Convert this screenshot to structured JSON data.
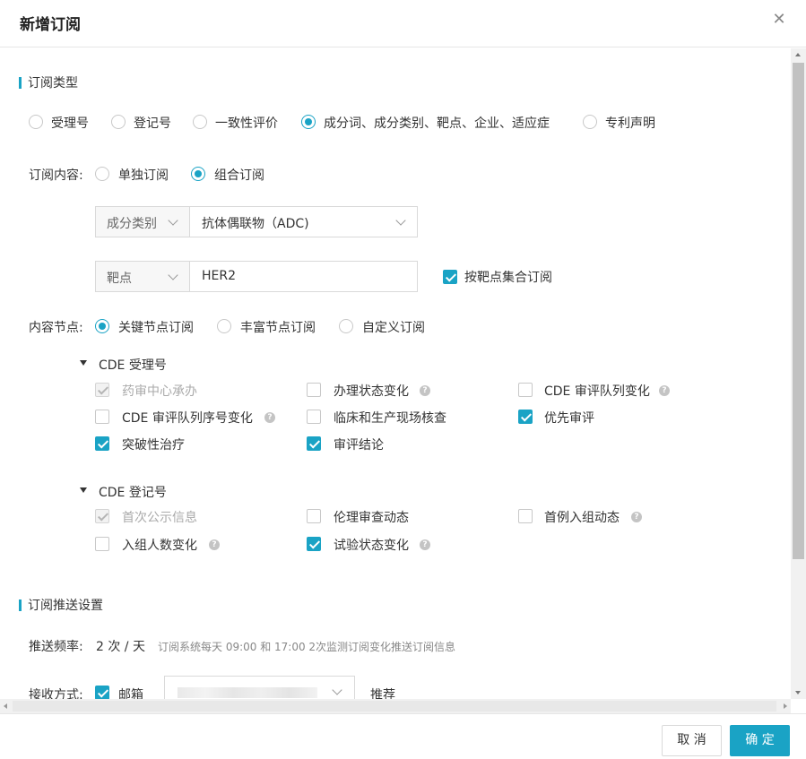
{
  "dialog": {
    "title": "新增订阅"
  },
  "section_type": {
    "title": "订阅类型",
    "options": [
      {
        "label": "受理号",
        "selected": false
      },
      {
        "label": "登记号",
        "selected": false
      },
      {
        "label": "一致性评价",
        "selected": false
      },
      {
        "label": "成分词、成分类别、靶点、企业、适应症",
        "selected": true
      },
      {
        "label": "专利声明",
        "selected": false
      }
    ]
  },
  "subscription_content": {
    "label": "订阅内容:",
    "options": [
      {
        "label": "单独订阅",
        "selected": false
      },
      {
        "label": "组合订阅",
        "selected": true
      }
    ]
  },
  "filters": [
    {
      "prefix": "成分类别",
      "value": "抗体偶联物（ADC)"
    },
    {
      "prefix": "靶点",
      "value": "HER2"
    }
  ],
  "aggregate_checkbox": {
    "label": "按靶点集合订阅",
    "checked": true
  },
  "content_node": {
    "label": "内容节点:",
    "options": [
      {
        "label": "关键节点订阅",
        "selected": true
      },
      {
        "label": "丰富节点订阅",
        "selected": false
      },
      {
        "label": "自定义订阅",
        "selected": false
      }
    ]
  },
  "groups": [
    {
      "title": "CDE 受理号",
      "items": [
        {
          "label": "药审中心承办",
          "state": "disabled-checked",
          "help": false
        },
        {
          "label": "办理状态变化",
          "state": "unchecked",
          "help": true
        },
        {
          "label": "CDE 审评队列变化",
          "state": "unchecked",
          "help": true
        },
        {
          "label": "CDE 审评队列序号变化",
          "state": "unchecked",
          "help": true
        },
        {
          "label": "临床和生产现场核查",
          "state": "unchecked",
          "help": false
        },
        {
          "label": "优先审评",
          "state": "checked",
          "help": false
        },
        {
          "label": "突破性治疗",
          "state": "checked",
          "help": false
        },
        {
          "label": "审评结论",
          "state": "checked",
          "help": false
        }
      ]
    },
    {
      "title": "CDE 登记号",
      "items": [
        {
          "label": "首次公示信息",
          "state": "disabled-checked",
          "help": false
        },
        {
          "label": "伦理审查动态",
          "state": "unchecked",
          "help": false
        },
        {
          "label": "首例入组动态",
          "state": "unchecked",
          "help": true
        },
        {
          "label": "入组人数变化",
          "state": "unchecked",
          "help": true
        },
        {
          "label": "试验状态变化",
          "state": "checked",
          "help": true
        }
      ]
    }
  ],
  "push_settings": {
    "title": "订阅推送设置",
    "frequency_label": "推送频率:",
    "frequency_value": "2 次 / 天",
    "frequency_note": "订阅系统每天 09:00 和 17:00 2次监测订阅变化推送订阅信息",
    "receive_label": "接收方式:",
    "email_label": "邮箱",
    "email_checked": true,
    "recommend_label": "推荐"
  },
  "footer": {
    "cancel_label": "取 消",
    "ok_label": "确 定"
  },
  "colors": {
    "accent": "#1aa3c5"
  },
  "icons": {
    "close": "close-icon",
    "help": "question-circle-icon",
    "chevron": "chevron-down-icon",
    "caret": "caret-down-icon"
  }
}
